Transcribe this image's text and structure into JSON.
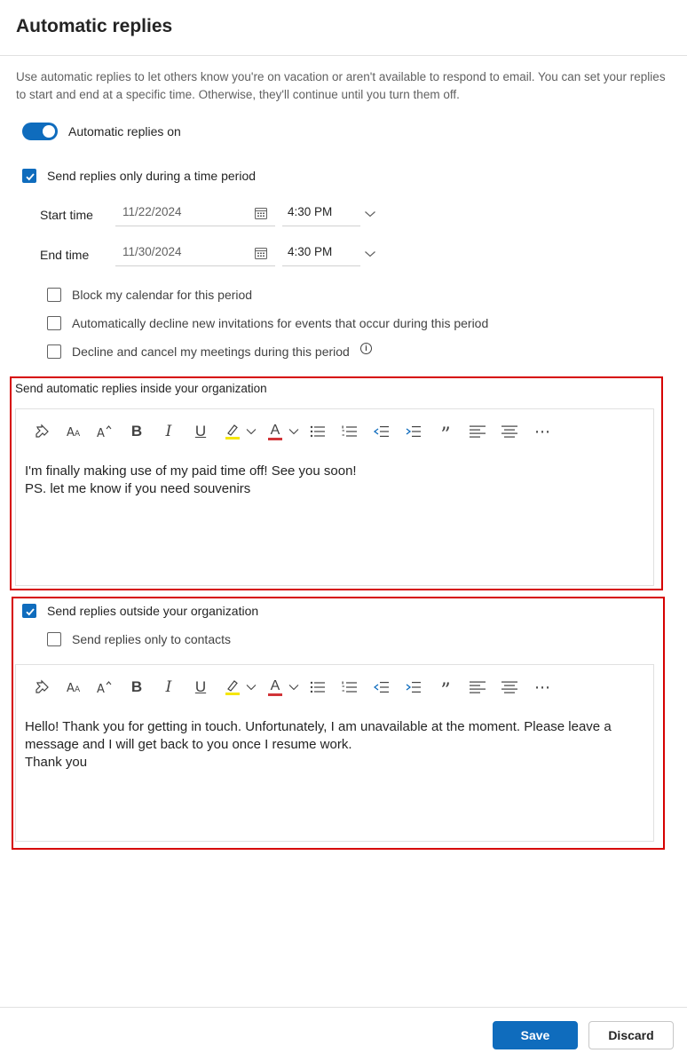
{
  "header": {
    "title": "Automatic replies"
  },
  "description": "Use automatic replies to let others know you're on vacation or aren't available to respond to email. You can set your replies to start and end at a specific time. Otherwise, they'll continue until you turn them off.",
  "toggle": {
    "label": "Automatic replies on",
    "on": true
  },
  "time_period": {
    "checkbox_label": "Send replies only during a time period",
    "checked": true,
    "start": {
      "label": "Start time",
      "date": "11/22/2024",
      "time": "4:30 PM"
    },
    "end": {
      "label": "End time",
      "date": "11/30/2024",
      "time": "4:30 PM"
    },
    "options": [
      {
        "label": "Block my calendar for this period",
        "checked": false
      },
      {
        "label": "Automatically decline new invitations for events that occur during this period",
        "checked": false
      },
      {
        "label": "Decline and cancel my meetings during this period",
        "checked": false
      }
    ],
    "info_glyph": "i"
  },
  "inside": {
    "label": "Send automatic replies inside your organization",
    "message": "I'm finally making use of my paid time off! See you soon!\nPS. let me know if you need souvenirs"
  },
  "outside": {
    "checkbox_label": "Send replies outside your organization",
    "checked": true,
    "contacts_label": "Send replies only to contacts",
    "contacts_checked": false,
    "message": "Hello! Thank you for getting in touch. Unfortunately, I am unavailable at the moment. Please leave a message and I will get back to you once I resume work.\nThank you"
  },
  "toolbar": {
    "icons": [
      "format-painter-icon",
      "font-size-icon",
      "grow-font-icon",
      "bold-icon",
      "italic-icon",
      "underline-icon",
      "highlight-icon",
      "chevron-down-icon",
      "font-color-icon",
      "chevron-down-icon",
      "bullets-icon",
      "numbering-icon",
      "decrease-indent-icon",
      "increase-indent-icon",
      "quote-icon",
      "align-left-icon",
      "align-center-icon",
      "more-icon"
    ],
    "bold_glyph": "B",
    "italic_glyph": "I",
    "underline_glyph": "U",
    "font_color_glyph": "A",
    "quote_glyph": "”",
    "more_glyph": "⋯",
    "highlight_color": "#f5e600",
    "font_color": "#d13438"
  },
  "footer": {
    "save_label": "Save",
    "discard_label": "Discard"
  },
  "colors": {
    "accent": "#0f6cbd",
    "annotation_red": "#d60000"
  }
}
